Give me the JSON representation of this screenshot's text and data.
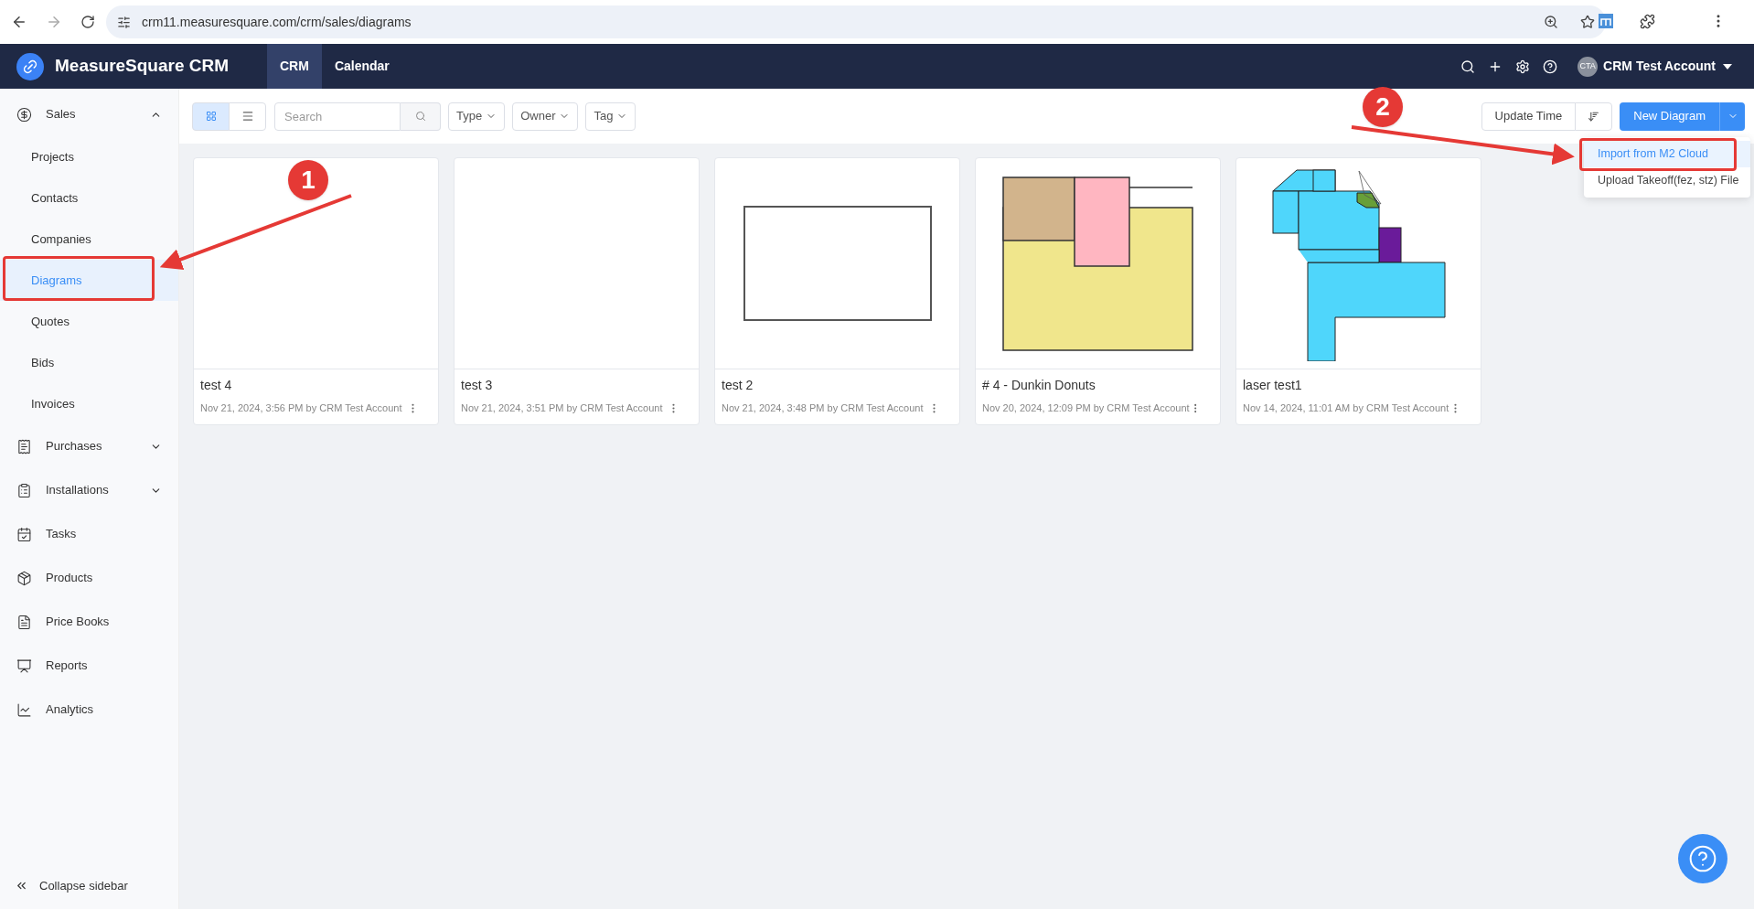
{
  "browser": {
    "url": "crm11.measuresquare.com/crm/sales/diagrams"
  },
  "header": {
    "app_name": "MeasureSquare CRM",
    "tabs": [
      {
        "label": "CRM",
        "selected": true
      },
      {
        "label": "Calendar",
        "selected": false
      }
    ],
    "avatar": "CTA",
    "account": "CRM Test Account"
  },
  "sidebar": {
    "items": [
      {
        "label": "Sales",
        "expanded": true,
        "children": [
          {
            "label": "Projects",
            "selected": false
          },
          {
            "label": "Contacts",
            "selected": false
          },
          {
            "label": "Companies",
            "selected": false
          },
          {
            "label": "Diagrams",
            "selected": true
          },
          {
            "label": "Quotes",
            "selected": false
          },
          {
            "label": "Bids",
            "selected": false
          },
          {
            "label": "Invoices",
            "selected": false
          }
        ]
      },
      {
        "label": "Purchases",
        "expanded": false
      },
      {
        "label": "Installations",
        "expanded": false
      },
      {
        "label": "Tasks"
      },
      {
        "label": "Products"
      },
      {
        "label": "Price Books"
      },
      {
        "label": "Reports"
      },
      {
        "label": "Analytics"
      }
    ],
    "collapse": "Collapse sidebar"
  },
  "toolbar": {
    "views": [
      {
        "kind": "grid",
        "selected": true
      },
      {
        "kind": "list",
        "selected": false
      }
    ],
    "search": {
      "placeholder": "Search"
    },
    "filters": [
      "Type",
      "Owner",
      "Tag"
    ],
    "sort": "Update Time",
    "new_button": "New Diagram"
  },
  "menu": [
    {
      "label": "Import from M2 Cloud",
      "selected": true
    },
    {
      "label": "Upload Takeoff(fez, stz) File",
      "selected": false
    }
  ],
  "cards": [
    {
      "title": "test 4",
      "meta": "Nov 21, 2024, 3:56 PM by CRM Test Account",
      "kind": "empty"
    },
    {
      "title": "test 3",
      "meta": "Nov 21, 2024, 3:51 PM by CRM Test Account",
      "kind": "empty"
    },
    {
      "title": "test 2",
      "meta": "Nov 21, 2024, 3:48 PM by CRM Test Account",
      "kind": "rectangle"
    },
    {
      "title": "# 4 - Dunkin Donuts",
      "meta": "Nov 20, 2024, 12:09 PM by CRM Test Account",
      "kind": "rooms"
    },
    {
      "title": "laser test1",
      "meta": "Nov 14, 2024, 11:01 AM by CRM Test Account",
      "kind": "floorplan"
    }
  ],
  "annotations": [
    {
      "label": "1"
    },
    {
      "label": "2"
    }
  ]
}
